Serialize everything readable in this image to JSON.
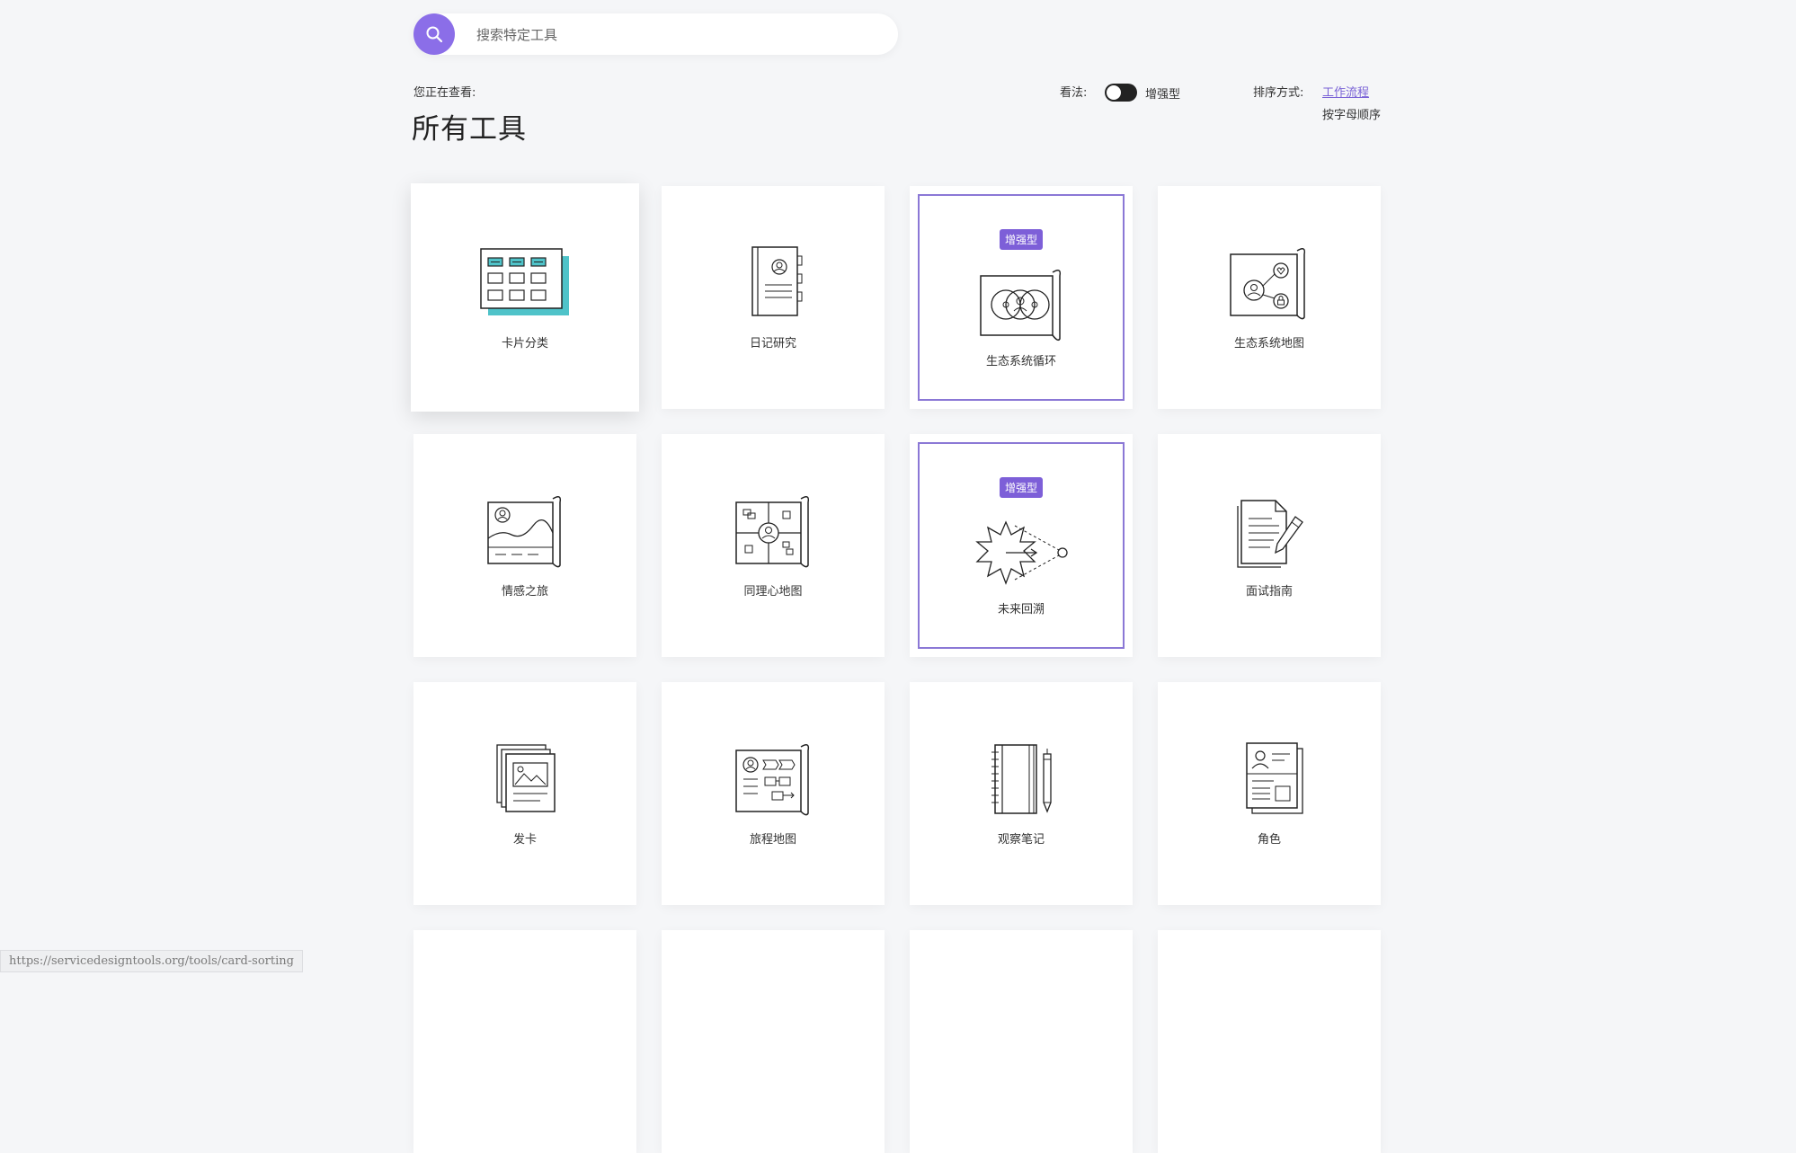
{
  "search": {
    "placeholder": "搜索特定工具",
    "icon": "search-icon"
  },
  "header": {
    "viewing_label": "您正在查看:",
    "title": "所有工具",
    "view_label": "看法:",
    "toggle_label": "增强型",
    "sort_label": "排序方式:",
    "sort_workflow": "工作流程",
    "sort_alpha": "按字母顺序"
  },
  "badge_text": "增强型",
  "accent_color": "#8b6ee8",
  "tools": [
    {
      "label": "卡片分类",
      "icon": "card-sorting-icon",
      "featured": false
    },
    {
      "label": "日记研究",
      "icon": "diary-study-icon",
      "featured": false
    },
    {
      "label": "生态系统循环",
      "icon": "ecosystem-cycle-icon",
      "featured": true
    },
    {
      "label": "生态系统地图",
      "icon": "ecosystem-map-icon",
      "featured": false
    },
    {
      "label": "情感之旅",
      "icon": "emotional-journey-icon",
      "featured": false
    },
    {
      "label": "同理心地图",
      "icon": "empathy-map-icon",
      "featured": false
    },
    {
      "label": "未来回溯",
      "icon": "backcasting-icon",
      "featured": true
    },
    {
      "label": "面试指南",
      "icon": "interview-guide-icon",
      "featured": false
    },
    {
      "label": "发卡",
      "icon": "card-deck-icon",
      "featured": false
    },
    {
      "label": "旅程地图",
      "icon": "journey-map-icon",
      "featured": false
    },
    {
      "label": "观察笔记",
      "icon": "observation-notes-icon",
      "featured": false
    },
    {
      "label": "角色",
      "icon": "persona-icon",
      "featured": false
    }
  ],
  "status_url": "https://servicedesigntools.org/tools/card-sorting"
}
